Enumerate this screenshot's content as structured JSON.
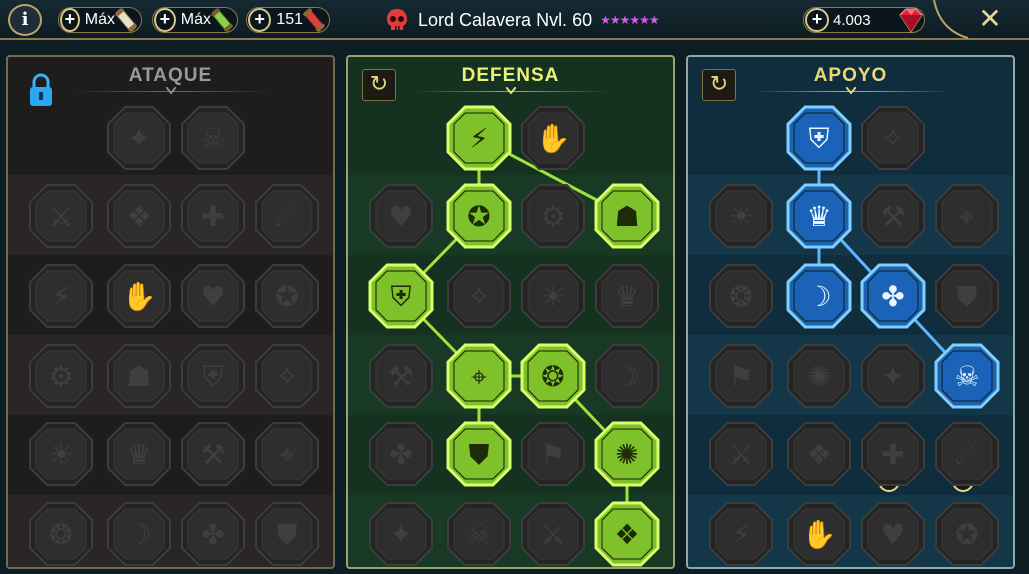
{
  "topbar": {
    "info_label": "i",
    "resources": [
      {
        "value": "Máx",
        "icon": "scroll-icon"
      },
      {
        "value": "Máx",
        "icon": "green-scroll-icon"
      },
      {
        "value": "151",
        "icon": "red-scroll-icon"
      }
    ],
    "champion_name": "Lord Calavera Nvl. 60",
    "stars": "★★★★★★",
    "gems": "4.003",
    "close_label": "✕"
  },
  "panels": {
    "attack": {
      "title": "ATAQUE",
      "locked": true
    },
    "defense": {
      "title": "DEFENSA",
      "reset_label": "↻"
    },
    "support": {
      "title": "APOYO",
      "reset_label": "↻"
    }
  },
  "colors": {
    "defense_active": "#b4f23c",
    "support_active": "#3aa6ff",
    "inactive": "#2c2c2c"
  },
  "add_buttons": [
    "+",
    "+"
  ]
}
